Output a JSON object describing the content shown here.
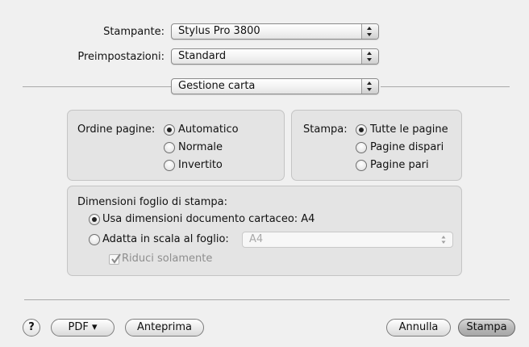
{
  "printer": {
    "label": "Stampante:",
    "value": "Stylus Pro 3800"
  },
  "presets": {
    "label": "Preimpostazioni:",
    "value": "Standard"
  },
  "panel": {
    "value": "Gestione carta"
  },
  "page_order": {
    "label": "Ordine pagine:",
    "options": [
      "Automatico",
      "Normale",
      "Invertito"
    ],
    "selected": "Automatico"
  },
  "print_pages": {
    "label": "Stampa:",
    "options": [
      "Tutte le pagine",
      "Pagine dispari",
      "Pagine pari"
    ],
    "selected": "Tutte le pagine"
  },
  "paper_size": {
    "label": "Dimensioni foglio di stampa:",
    "use_document_label": "Usa dimensioni documento cartaceo: A4",
    "scale_label": "Adatta in scala al foglio:",
    "scale_value": "A4",
    "reduce_only_label": "Riduci solamente",
    "selected": "use_document"
  },
  "footer": {
    "help": "?",
    "pdf": "PDF ▾",
    "preview": "Anteprima",
    "cancel": "Annulla",
    "print": "Stampa"
  }
}
